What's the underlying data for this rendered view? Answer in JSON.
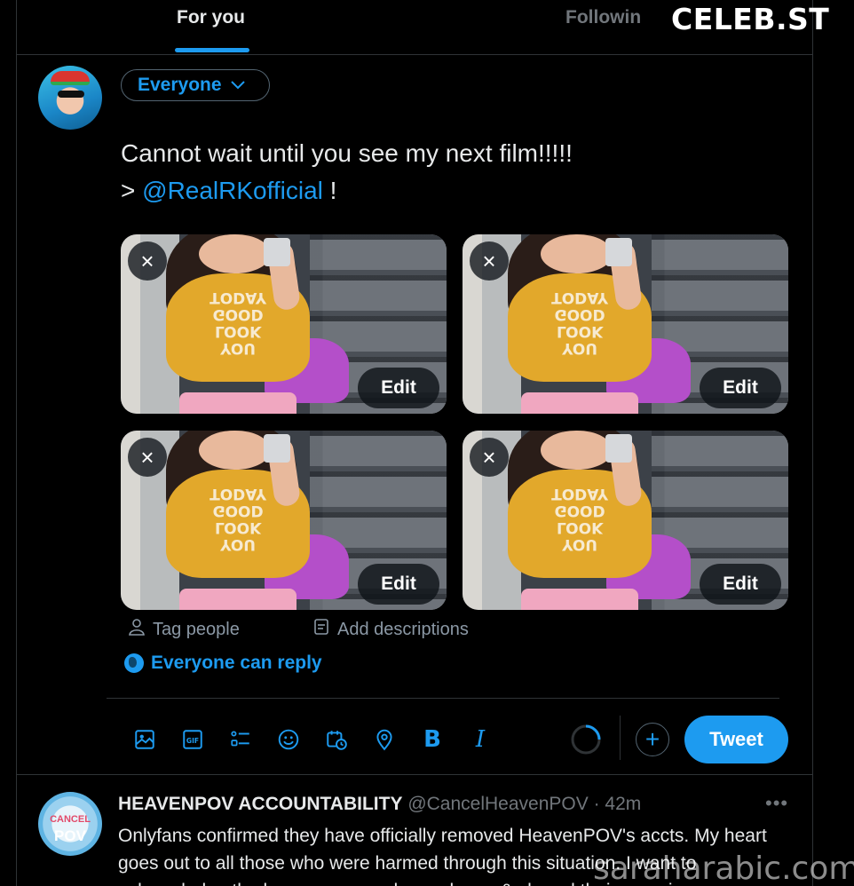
{
  "tabs": {
    "for_you": "For you",
    "following": "Followin"
  },
  "watermark_top": "CELEB.ST",
  "watermark_bottom": "saraharabic.com",
  "composer": {
    "audience": "Everyone",
    "text_line1": "Cannot wait until you see my next film!!!!!",
    "text_prefix": "> ",
    "mention": "@RealRKofficial",
    "text_suffix": " !",
    "shirt_text": "YOU\nLOOK\nGOOD\nTODAY",
    "media": [
      {
        "close_icon": "×",
        "edit_label": "Edit"
      },
      {
        "close_icon": "×",
        "edit_label": "Edit"
      },
      {
        "close_icon": "×",
        "edit_label": "Edit"
      },
      {
        "close_icon": "×",
        "edit_label": "Edit"
      }
    ],
    "tag_people": "Tag people",
    "add_descriptions": "Add descriptions",
    "reply_setting": "Everyone can reply",
    "tweet_button": "Tweet",
    "add_button": "+",
    "toolbar_icons": [
      "image-icon",
      "gif-icon",
      "poll-icon",
      "emoji-icon",
      "schedule-icon",
      "location-icon",
      "bold-icon",
      "italic-icon"
    ],
    "bold_glyph": "B",
    "italic_glyph": "I"
  },
  "next_tweet": {
    "avatar_top": "CANCEL",
    "avatar_bottom": "POV",
    "name": "HEAVENPOV ACCOUNTABILITY",
    "handle": "@CancelHeavenPOV",
    "time": "· 42m",
    "more": "•••",
    "body": "Onlyfans confirmed they have officially removed HeavenPOV's accts. My heart goes out to all those who were harmed through this situation. I want to acknowledge the brave women who spoke up & shared their experiences"
  },
  "colors": {
    "accent": "#1d9bf0",
    "background": "#000000",
    "border": "#2f3336",
    "muted": "#71767b"
  }
}
